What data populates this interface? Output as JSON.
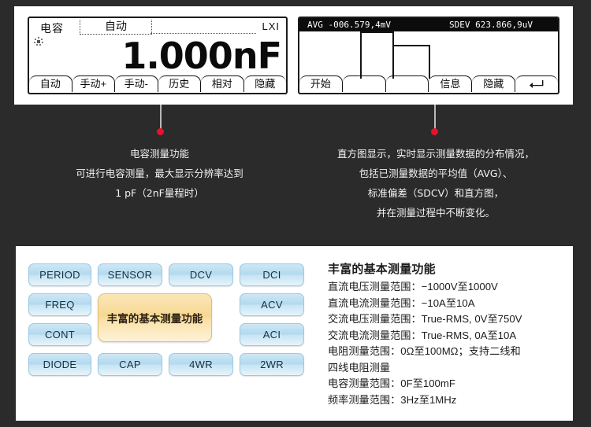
{
  "left_display": {
    "mode_label": "电容",
    "range_label": "自动",
    "lxi_label": "LXI",
    "reading": "1.000nF",
    "softkeys": [
      "自动",
      "手动+",
      "手动-",
      "历史",
      "相对",
      "隐藏"
    ]
  },
  "right_display": {
    "avg_label": "AVG",
    "avg_value": "-006.579,4mV",
    "sdev_label": "SDEV",
    "sdev_value": "623.866,9uV",
    "statline_left": "AVG  -006.579,4mV",
    "statline_right": "SDEV   623.866,9uV",
    "softkeys": [
      "开始",
      "",
      "",
      "信息",
      "隐藏",
      "⬋"
    ],
    "return_icon": "return-arrow-icon",
    "histogram": {
      "bars": [
        {
          "left_pct": 23.5,
          "width_pct": 13.0,
          "height_pct": 100
        },
        {
          "left_pct": 36.0,
          "width_pct": 14.5,
          "height_pct": 72
        }
      ]
    }
  },
  "callouts": [
    {
      "title": "电容测量功能",
      "lines": [
        "可进行电容测量，最大显示分辨率达到",
        "1 pF（2nF量程时）"
      ]
    },
    {
      "title": "",
      "lines": [
        "直方图显示，实时显示测量数据的分布情况，",
        "包括已测量数据的平均值（AVG）、",
        "标准偏差（SDCV）和直方图，",
        "并在测量过程中不断变化。"
      ]
    }
  ],
  "function_grid": {
    "buttons": [
      "PERIOD",
      "SENSOR",
      "DCV",
      "DCI",
      "FREQ",
      "ACV",
      "CONT",
      "ACI",
      "DIODE",
      "CAP",
      "4WR",
      "2WR"
    ],
    "center_label": "丰富的基本测量功能"
  },
  "specs": {
    "heading": "丰富的基本测量功能",
    "lines": [
      "直流电压测量范围：−1000V至1000V",
      "直流电流测量范围：−10A至10A",
      "交流电压测量范围：True-RMS, 0V至750V",
      "交流电流测量范围：True-RMS, 0A至10A",
      "电阻测量范围：0Ω至100MΩ；支持二线和",
      "四线电阻测量",
      "电容测量范围：0F至100mF",
      "频率测量范围：3Hz至1MHz"
    ]
  },
  "colors": {
    "background": "#2b2b2b",
    "panel": "#ffffff",
    "dot": "#e8122a",
    "button_blue": "#b3d9ee",
    "center_amber": "#f7d893"
  }
}
